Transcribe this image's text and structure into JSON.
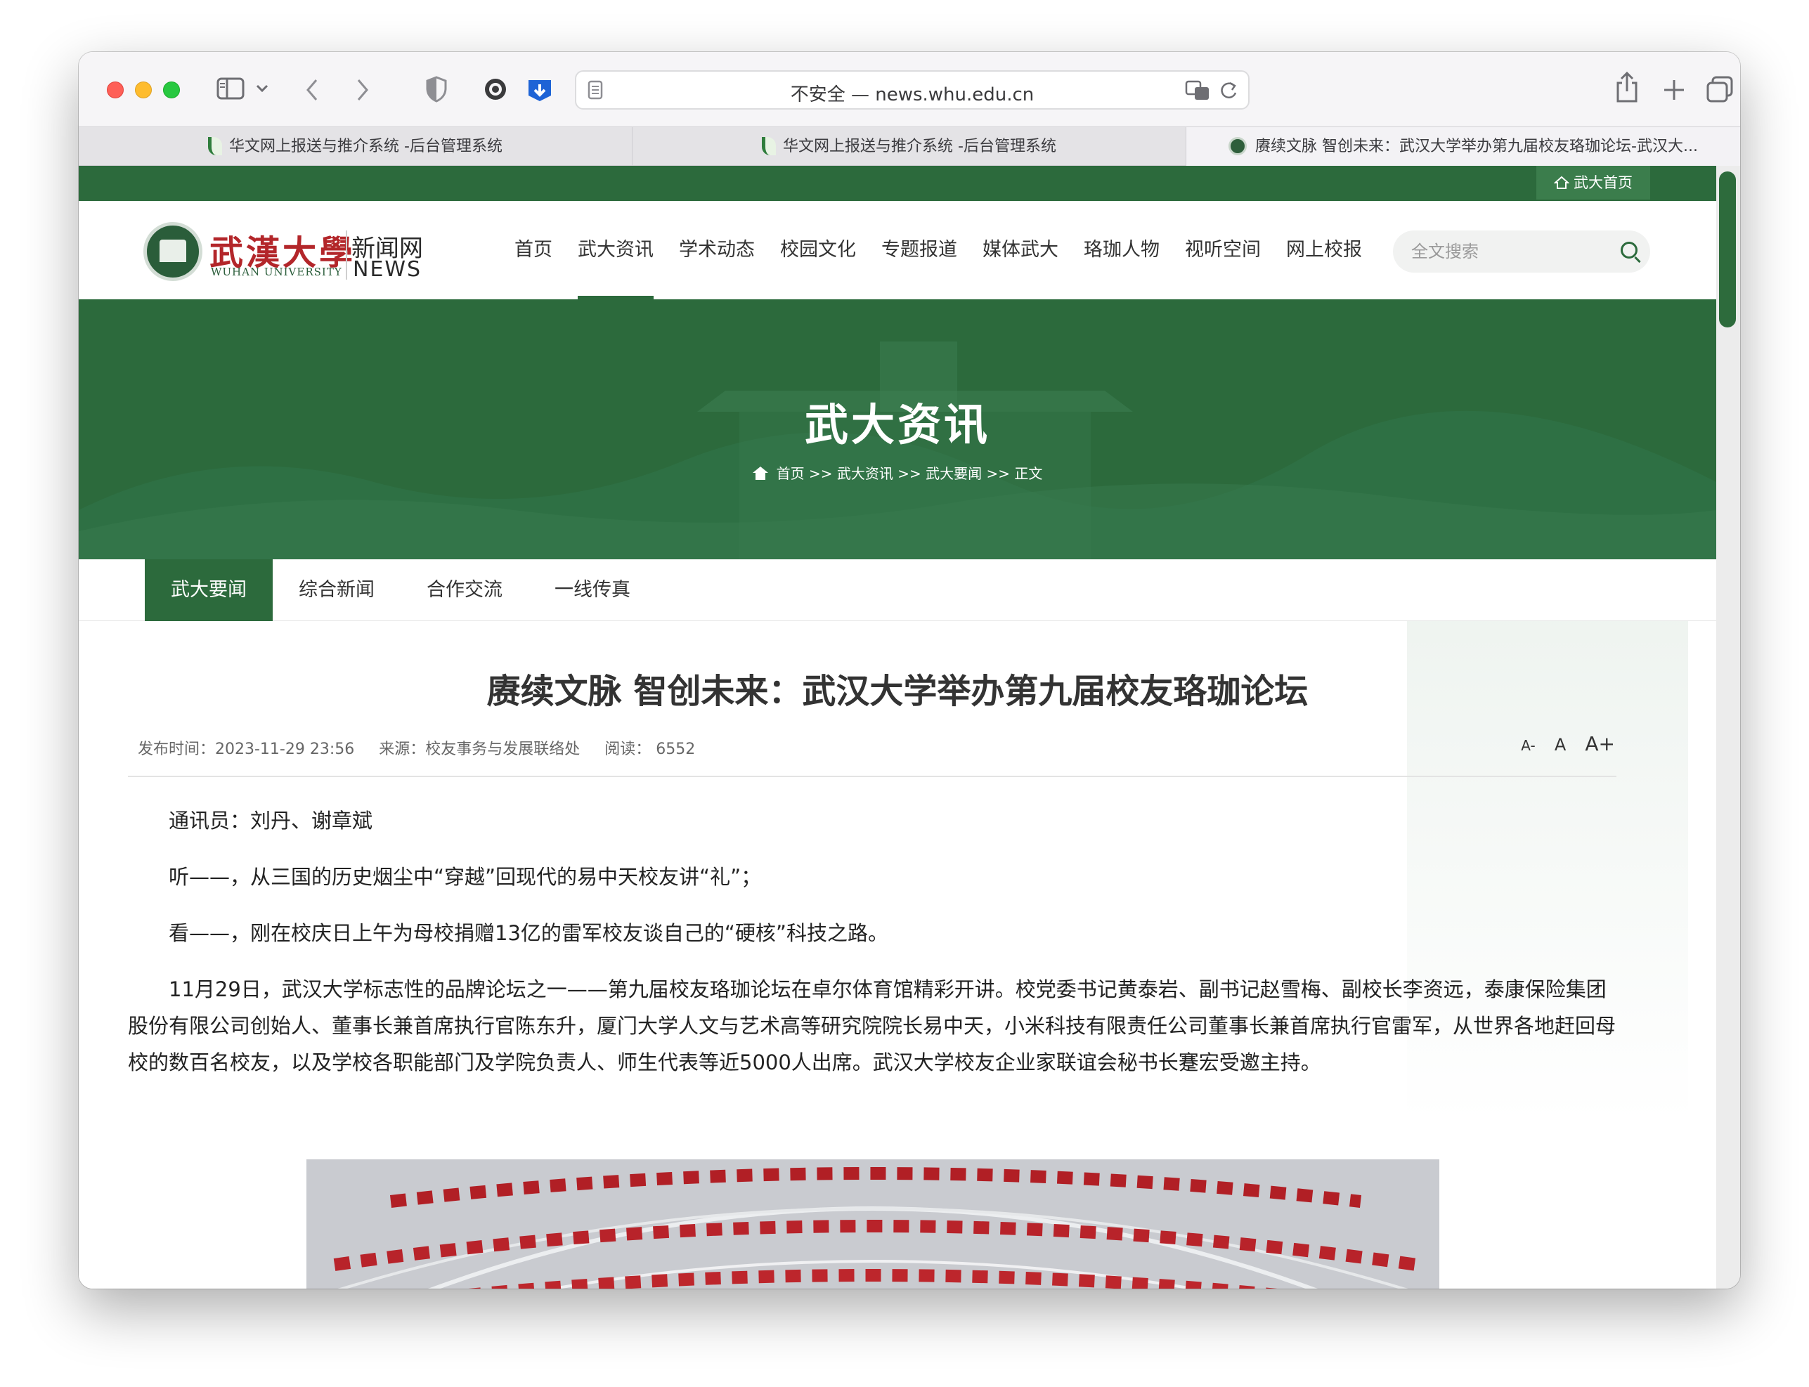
{
  "browser": {
    "url": "不安全 — news.whu.edu.cn",
    "tabs": [
      {
        "title": "华文网上报送与推介系统 -后台管理系统"
      },
      {
        "title": "华文网上报送与推介系统 -后台管理系统"
      },
      {
        "title": "赓续文脉 智创未来：武汉大学举办第九届校友珞珈论坛-武汉大..."
      }
    ]
  },
  "site": {
    "home_link": "武大首页",
    "logo_cn": "武漢大學",
    "logo_en": "WUHAN UNIVERSITY",
    "logo_news_cn": "新闻网",
    "logo_news_en": "NEWS",
    "nav": [
      "首页",
      "武大资讯",
      "学术动态",
      "校园文化",
      "专题报道",
      "媒体武大",
      "珞珈人物",
      "视听空间",
      "网上校报"
    ],
    "active_nav_index": 1,
    "search_placeholder": "全文搜索"
  },
  "banner": {
    "title": "武大资讯",
    "breadcrumb": "首页 >> 武大资讯 >> 武大要闻 >> 正文"
  },
  "subnav": {
    "items": [
      "武大要闻",
      "综合新闻",
      "合作交流",
      "一线传真"
    ],
    "active_index": 0
  },
  "article": {
    "title": "赓续文脉 智创未来：武汉大学举办第九届校友珞珈论坛",
    "publish_time": "发布时间：2023-11-29 23:56",
    "source": "来源：校友事务与发展联络处",
    "reads": "阅读：  6552",
    "font_sizes": [
      "A-",
      "A",
      "A+"
    ],
    "paragraphs": [
      "通讯员：刘丹、谢章斌",
      "听——，从三国的历史烟尘中“穿越”回现代的易中天校友讲“礼”；",
      "看——，刚在校庆日上午为母校捐赠13亿的雷军校友谈自己的“硬核”科技之路。",
      "11月29日，武汉大学标志性的品牌论坛之一——第九届校友珞珈论坛在卓尔体育馆精彩开讲。校党委书记黄泰岩、副书记赵雪梅、副校长李资远，泰康保险集团股份有限公司创始人、董事长兼首席执行官陈东升，厦门大学人文与艺术高等研究院院长易中天，小米科技有限责任公司董事长兼首席执行官雷军，从世界各地赶回母校的数百名校友，以及学校各职能部门及学院负责人、师生代表等近5000人出席。武汉大学校友企业家联谊会秘书长蹇宏受邀主持。"
    ]
  }
}
